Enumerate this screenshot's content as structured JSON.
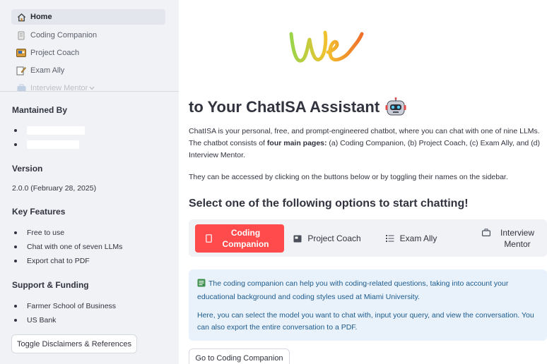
{
  "nav": {
    "items": [
      {
        "label": "Home",
        "icon": "home-icon",
        "active": true
      },
      {
        "label": "Coding Companion",
        "icon": "code-icon"
      },
      {
        "label": "Project Coach",
        "icon": "presentation-icon"
      },
      {
        "label": "Exam Ally",
        "icon": "pencil-note-icon"
      },
      {
        "label": "Interview Mentor",
        "icon": "briefcase-icon"
      }
    ],
    "overflow_indicator": "chevron-down-icon"
  },
  "sidebar": {
    "maintained_heading": "Mantained By",
    "version_heading": "Version",
    "version_value": "2.0.0 (February 28, 2025)",
    "features_heading": "Key Features",
    "features": [
      "Free to use",
      "Chat with one of seven LLMs",
      "Export chat to PDF"
    ],
    "support_heading": "Support & Funding",
    "support": [
      "Farmer School of Business",
      "US Bank"
    ],
    "toggle_button": "Toggle Disclaimers & References"
  },
  "main": {
    "title": "to Your ChatISA Assistant",
    "intro_pre": "ChatISA is your personal, free, and prompt-engineered chatbot, where you can chat with one of nine LLMs. The chatbot consists of ",
    "intro_bold": "four main pages:",
    "intro_post": " (a) Coding Companion, (b) Project Coach, (c) Exam Ally, and (d) Interview Mentor.",
    "access_text": "They can be accessed by clicking on the buttons below or by toggling their names on the sidebar.",
    "options_heading": "Select one of the following options to start chatting!",
    "tabs": [
      {
        "label": "Coding Companion",
        "icon": "code-icon",
        "active": true
      },
      {
        "label": "Project Coach",
        "icon": "presentation-icon"
      },
      {
        "label": "Exam Ally",
        "icon": "list-icon"
      },
      {
        "label": "Interview Mentor",
        "icon": "briefcase-icon"
      }
    ],
    "info_line1": "The coding companion can help you with coding-related questions, taking into account your educational background and coding styles used at Miami University.",
    "info_line2": "Here, you can select the model you want to chat with, input your query, and view the conversation. You can also export the entire conversation to a PDF.",
    "go_button": "Go to Coding Companion"
  },
  "colors": {
    "accent": "#ff4b4b",
    "sidebar_bg": "#f0f2f6",
    "info_bg": "#e9f2fb",
    "info_text": "#1c5a8c"
  }
}
